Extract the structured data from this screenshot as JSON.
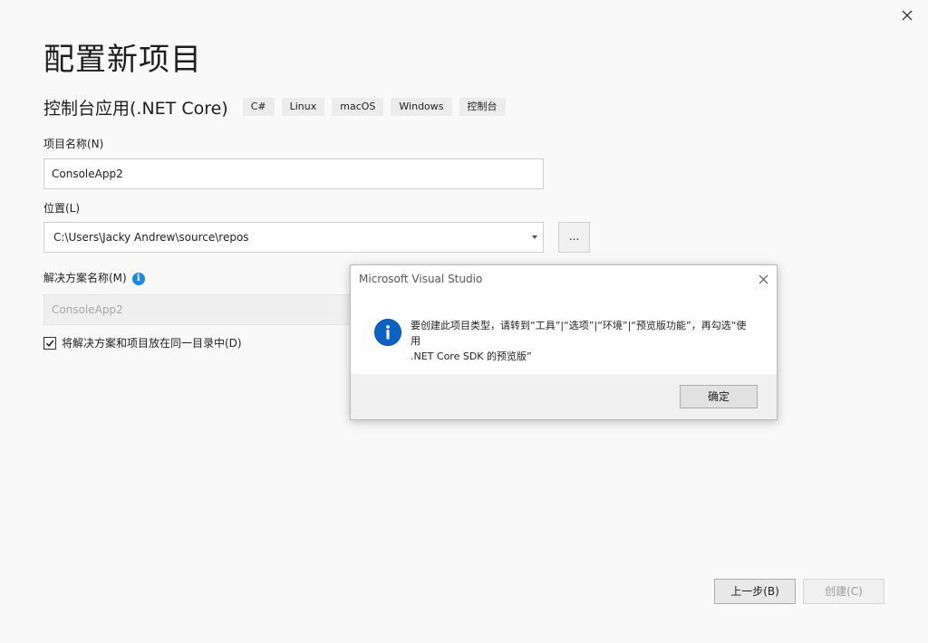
{
  "page": {
    "title": "配置新项目",
    "template_name": "控制台应用(.NET Core)",
    "tags": [
      "C#",
      "Linux",
      "macOS",
      "Windows",
      "控制台"
    ]
  },
  "form": {
    "project_name_label": "项目名称(N)",
    "project_name_value": "ConsoleApp2",
    "location_label": "位置(L)",
    "location_value": "C:\\Users\\Jacky Andrew\\source\\repos",
    "browse_label": "...",
    "solution_name_label": "解决方案名称(M)",
    "solution_name_value": "ConsoleApp2",
    "same_dir_label": "将解决方案和项目放在同一目录中(D)",
    "same_dir_checked": true
  },
  "buttons": {
    "back": "上一步(B)",
    "create": "创建(C)"
  },
  "dialog": {
    "title": "Microsoft Visual Studio",
    "message_line1": "要创建此项目类型，请转到“工具”|“选项”|“环境”|“预览版功能”，再勾选“使用",
    "message_line2": ".NET Core SDK 的预览版”",
    "ok": "确定"
  },
  "icons": {
    "window_close": "close-icon",
    "dialog_close": "close-icon",
    "info_small": "info-icon",
    "info_big": "info-icon",
    "checkbox_mark": "check-icon",
    "combo_arrow": "chevron-down-icon"
  },
  "colors": {
    "accent_blue": "#0a62c4",
    "info_blue": "#1e88e5",
    "background": "#f9f9f9"
  }
}
